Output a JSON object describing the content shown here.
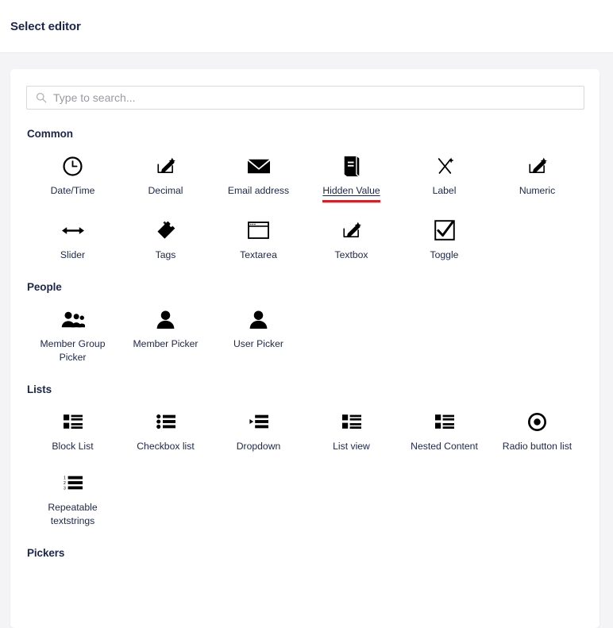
{
  "header": {
    "title": "Select editor"
  },
  "search": {
    "placeholder": "Type to search...",
    "value": "",
    "icon": "search-icon"
  },
  "selected_editor": "Hidden Value",
  "accent_color": "#e01b22",
  "groups": [
    {
      "id": "common",
      "title": "Common",
      "items": [
        {
          "label": "Date/Time",
          "icon": "clock-icon"
        },
        {
          "label": "Decimal",
          "icon": "pencil-box-icon"
        },
        {
          "label": "Email address",
          "icon": "envelope-icon"
        },
        {
          "label": "Hidden Value",
          "icon": "book-icon",
          "selected": true
        },
        {
          "label": "Label",
          "icon": "crossed-pen-icon"
        },
        {
          "label": "Numeric",
          "icon": "pencil-box-icon"
        },
        {
          "label": "Slider",
          "icon": "double-arrow-icon"
        },
        {
          "label": "Tags",
          "icon": "tag-icon"
        },
        {
          "label": "Textarea",
          "icon": "window-icon"
        },
        {
          "label": "Textbox",
          "icon": "pencil-box-icon"
        },
        {
          "label": "Toggle",
          "icon": "checkbox-check-icon"
        }
      ]
    },
    {
      "id": "people",
      "title": "People",
      "items": [
        {
          "label": "Member Group Picker",
          "icon": "people-group-icon"
        },
        {
          "label": "Member Picker",
          "icon": "person-icon"
        },
        {
          "label": "User Picker",
          "icon": "person-icon"
        }
      ]
    },
    {
      "id": "lists",
      "title": "Lists",
      "items": [
        {
          "label": "Block List",
          "icon": "block-list-icon"
        },
        {
          "label": "Checkbox list",
          "icon": "bullet-list-icon"
        },
        {
          "label": "Dropdown",
          "icon": "dropdown-list-icon"
        },
        {
          "label": "List view",
          "icon": "block-list-icon"
        },
        {
          "label": "Nested Content",
          "icon": "block-list-icon"
        },
        {
          "label": "Radio button list",
          "icon": "radio-dot-icon"
        },
        {
          "label": "Repeatable textstrings",
          "icon": "numbered-list-icon"
        }
      ]
    },
    {
      "id": "pickers",
      "title": "Pickers",
      "items": []
    }
  ]
}
